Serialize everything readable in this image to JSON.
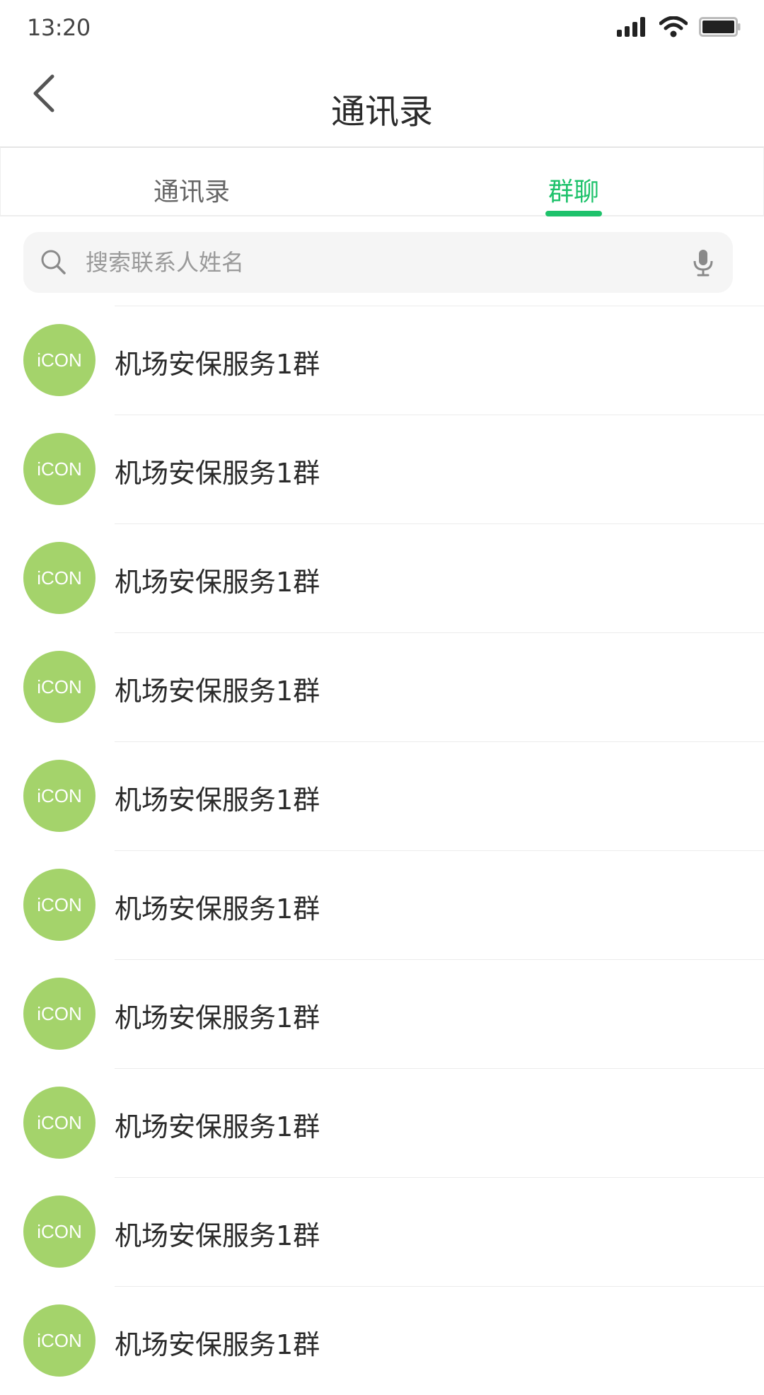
{
  "status_bar": {
    "time": "13:20",
    "icons": [
      "signal-icon",
      "wifi-icon",
      "battery-icon"
    ]
  },
  "header": {
    "title": "通讯录",
    "back_icon": "chevron-left-icon"
  },
  "tabs": [
    {
      "label": "通讯录",
      "active": false
    },
    {
      "label": "群聊",
      "active": true
    }
  ],
  "search": {
    "placeholder": "搜索联系人姓名",
    "value": ""
  },
  "groups": [
    {
      "avatar_text": "iCON",
      "name": "机场安保服务1群"
    },
    {
      "avatar_text": "iCON",
      "name": "机场安保服务1群"
    },
    {
      "avatar_text": "iCON",
      "name": "机场安保服务1群"
    },
    {
      "avatar_text": "iCON",
      "name": "机场安保服务1群"
    },
    {
      "avatar_text": "iCON",
      "name": "机场安保服务1群"
    },
    {
      "avatar_text": "iCON",
      "name": "机场安保服务1群"
    },
    {
      "avatar_text": "iCON",
      "name": "机场安保服务1群"
    },
    {
      "avatar_text": "iCON",
      "name": "机场安保服务1群"
    },
    {
      "avatar_text": "iCON",
      "name": "机场安保服务1群"
    },
    {
      "avatar_text": "iCON",
      "name": "机场安保服务1群"
    }
  ],
  "colors": {
    "accent": "#1ec26b",
    "avatar": "#a4d36b"
  }
}
